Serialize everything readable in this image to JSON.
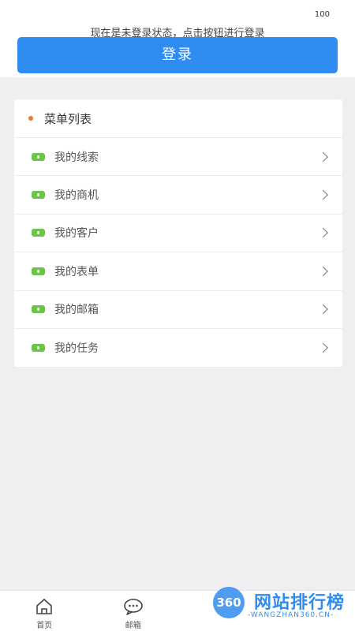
{
  "status": {
    "number": "100"
  },
  "login": {
    "notice": "现在是未登录状态，点击按钮进行登录",
    "button_label": "登录"
  },
  "menu": {
    "title": "菜单列表",
    "items": [
      {
        "label": "我的线索"
      },
      {
        "label": "我的商机"
      },
      {
        "label": "我的客户"
      },
      {
        "label": "我的表单"
      },
      {
        "label": "我的邮箱"
      },
      {
        "label": "我的任务"
      }
    ]
  },
  "tabbar": {
    "tabs": [
      {
        "label": "首页",
        "icon": "home-icon"
      },
      {
        "label": "邮箱",
        "icon": "chat-icon"
      }
    ]
  },
  "watermark": {
    "badge": "360",
    "text": "网站排行榜",
    "sub": "-WANGZHAN360.CN-"
  },
  "colors": {
    "primary": "#2f8cf0",
    "dot": "#f07a2a",
    "icon_green": "#6cc44a",
    "background": "#efeff1"
  }
}
